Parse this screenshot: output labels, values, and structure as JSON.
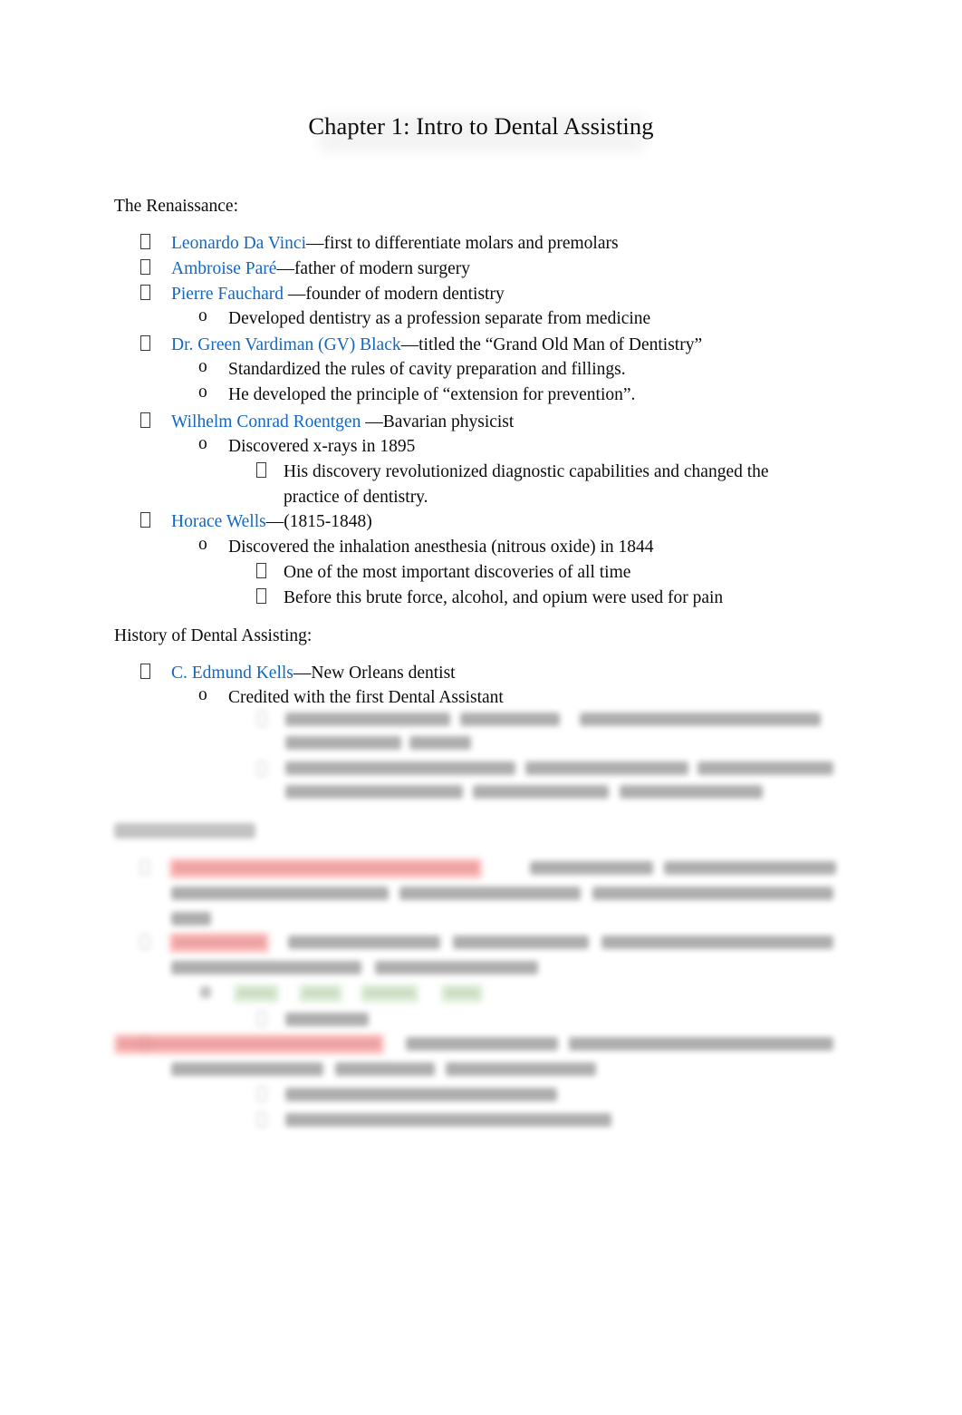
{
  "document": {
    "title": "Chapter 1: Intro to Dental Assisting",
    "background_color": "#ffffff",
    "text_color": "#0c0c0c",
    "link_color": "#1268c3",
    "highlight_red": "#ff8f8f",
    "highlight_green": "#c3e3b6",
    "bullet_glyph": "missing-glyph-box"
  },
  "sections": {
    "renaissance": {
      "heading": "The Renaissance:",
      "items": [
        {
          "name": "Leonardo Da Vinci",
          "rest": "—first to differentiate molars and premolars",
          "sub": []
        },
        {
          "name": "Ambroise Paré",
          "rest": "—father of modern surgery",
          "sub": []
        },
        {
          "name": "Pierre Fauchard ",
          "rest": "—founder of modern dentistry",
          "sub": [
            {
              "text": "Developed dentistry as a profession separate from medicine",
              "sub3": []
            }
          ]
        },
        {
          "name": "Dr. Green Vardiman (GV) Black",
          "rest": "—titled the “Grand Old Man of Dentistry”",
          "sub": [
            {
              "text": "Standardized the rules of cavity preparation and fillings.",
              "sub3": []
            },
            {
              "text": "He developed the principle of “extension for prevention”.",
              "sub3": []
            }
          ]
        },
        {
          "name": "Wilhelm Conrad Roentgen ",
          "rest": "—Bavarian physicist",
          "sub": [
            {
              "text": "Discovered x-rays in 1895",
              "sub3": [
                "His discovery revolutionized diagnostic capabilities and changed the practice of dentistry."
              ]
            }
          ]
        },
        {
          "name": "Horace Wells",
          "rest": "—(1815-1848)",
          "sub": [
            {
              "text": "Discovered the inhalation anesthesia (nitrous oxide) in 1844",
              "sub3": [
                "One of the most important discoveries of all time",
                "Before this brute force, alcohol, and opium were used for pain"
              ]
            }
          ]
        }
      ]
    },
    "history": {
      "heading": "History of Dental Assisting:",
      "items": [
        {
          "name": "C. Edmund Kells",
          "rest": "—New Orleans dentist",
          "sub": [
            {
              "text": "Credited with the first Dental Assistant",
              "sub3_obscured": 2
            }
          ]
        }
      ]
    },
    "specialties": {
      "heading_obscured": true,
      "obscured_note": "Remaining content on this page is blurred and unreadable."
    }
  }
}
